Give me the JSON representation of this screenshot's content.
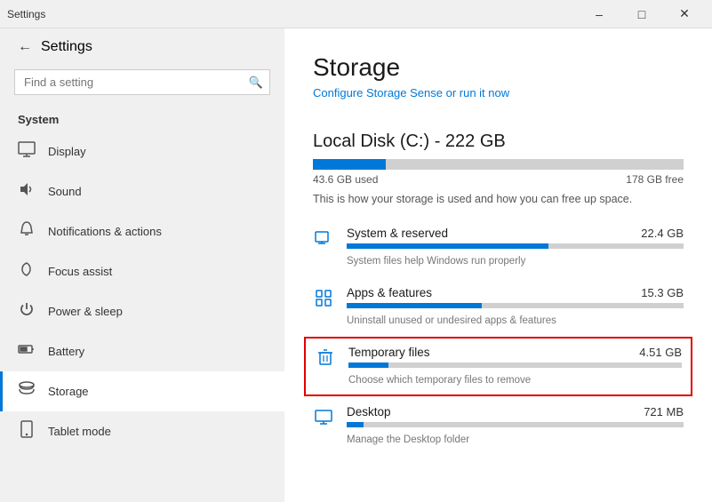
{
  "titleBar": {
    "title": "Settings",
    "minimize": "–",
    "maximize": "□",
    "close": "✕"
  },
  "sidebar": {
    "backLabel": "Settings",
    "searchPlaceholder": "Find a setting",
    "sectionLabel": "System",
    "items": [
      {
        "id": "display",
        "label": "Display",
        "icon": "display"
      },
      {
        "id": "sound",
        "label": "Sound",
        "icon": "sound"
      },
      {
        "id": "notifications",
        "label": "Notifications & actions",
        "icon": "notifications"
      },
      {
        "id": "focus",
        "label": "Focus assist",
        "icon": "focus"
      },
      {
        "id": "power",
        "label": "Power & sleep",
        "icon": "power"
      },
      {
        "id": "battery",
        "label": "Battery",
        "icon": "battery"
      },
      {
        "id": "storage",
        "label": "Storage",
        "icon": "storage",
        "active": true
      },
      {
        "id": "tablet",
        "label": "Tablet mode",
        "icon": "tablet"
      }
    ]
  },
  "main": {
    "pageTitle": "Storage",
    "configureLink": "Configure Storage Sense or run it now",
    "diskTitle": "Local Disk (C:) - 222 GB",
    "diskUsed": "43.6 GB used",
    "diskFree": "178 GB free",
    "diskUsedPercent": 19.6,
    "diskDescription": "This is how your storage is used and how you can free up space.",
    "storageItems": [
      {
        "id": "system",
        "name": "System & reserved",
        "size": "22.4 GB",
        "desc": "System files help Windows run properly",
        "barPercent": 60,
        "icon": "system",
        "highlighted": false
      },
      {
        "id": "apps",
        "name": "Apps & features",
        "size": "15.3 GB",
        "desc": "Uninstall unused or undesired apps & features",
        "barPercent": 40,
        "icon": "apps",
        "highlighted": false
      },
      {
        "id": "temp",
        "name": "Temporary files",
        "size": "4.51 GB",
        "desc": "Choose which temporary files to remove",
        "barPercent": 12,
        "icon": "trash",
        "highlighted": true
      },
      {
        "id": "desktop",
        "name": "Desktop",
        "size": "721 MB",
        "desc": "Manage the Desktop folder",
        "barPercent": 5,
        "icon": "desktop",
        "highlighted": false
      }
    ]
  }
}
